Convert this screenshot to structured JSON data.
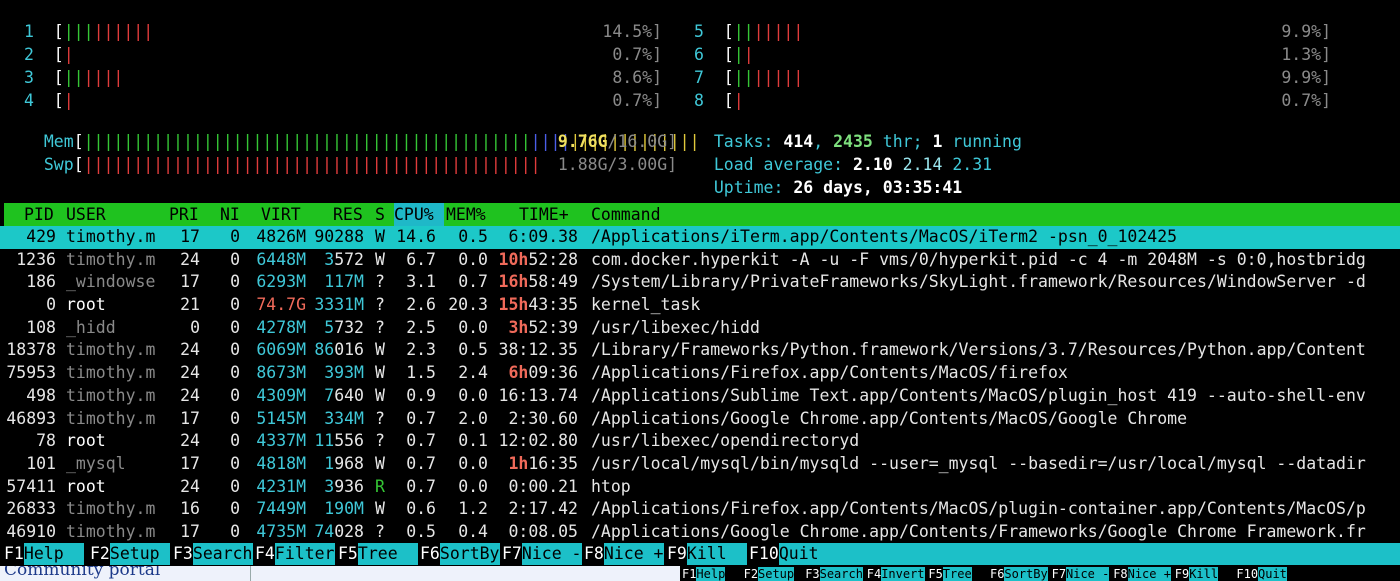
{
  "cpus": [
    {
      "id": "1",
      "pct": "14.5%]",
      "bars": [
        {
          "c": "green",
          "n": 3
        },
        {
          "c": "red",
          "n": 6
        }
      ]
    },
    {
      "id": "2",
      "pct": "0.7%]",
      "bars": [
        {
          "c": "red",
          "n": 1
        }
      ]
    },
    {
      "id": "3",
      "pct": "8.6%]",
      "bars": [
        {
          "c": "green",
          "n": 2
        },
        {
          "c": "red",
          "n": 4
        }
      ]
    },
    {
      "id": "4",
      "pct": "0.7%]",
      "bars": [
        {
          "c": "red",
          "n": 1
        }
      ]
    },
    {
      "id": "5",
      "pct": "9.9%]",
      "bars": [
        {
          "c": "green",
          "n": 2
        },
        {
          "c": "red",
          "n": 5
        }
      ]
    },
    {
      "id": "6",
      "pct": "1.3%]",
      "bars": [
        {
          "c": "green",
          "n": 1
        },
        {
          "c": "red",
          "n": 1
        }
      ]
    },
    {
      "id": "7",
      "pct": "9.9%]",
      "bars": [
        {
          "c": "green",
          "n": 2
        },
        {
          "c": "red",
          "n": 5
        }
      ]
    },
    {
      "id": "8",
      "pct": "0.7%]",
      "bars": [
        {
          "c": "red",
          "n": 1
        }
      ]
    }
  ],
  "mem": {
    "label": "Mem",
    "used": "9.76G",
    "total": "/16.0G]",
    "bars": [
      {
        "c": "green",
        "n": 45
      },
      {
        "c": "blue",
        "n": 4
      },
      {
        "c": "yellow",
        "n": 13
      }
    ]
  },
  "swp": {
    "label": "Swp",
    "used": "1.88G",
    "total": "/3.00G]",
    "bars": [
      {
        "c": "red",
        "n": 46
      }
    ]
  },
  "tasks": {
    "label": "Tasks:",
    "count": "414",
    "sep1": ", ",
    "threads": "2435",
    "thr": " thr;",
    "running": "1",
    "running_label": " running"
  },
  "load": {
    "label": "Load average:",
    "l1": "2.10",
    "l5": "2.14",
    "l15": "2.31"
  },
  "uptime": {
    "label": "Uptime:",
    "value": "26 days, 03:35:41"
  },
  "columns": {
    "pid": "PID",
    "user": "USER",
    "pri": "PRI",
    "ni": "NI",
    "virt": "VIRT",
    "res": "RES",
    "s": "S",
    "cpu": "CPU%",
    "mem": "MEM%",
    "time": "TIME+",
    "command": "Command"
  },
  "processes": [
    {
      "pid": "429",
      "user": "timothy.m",
      "pri": "17",
      "ni": "0",
      "virt": "4826M",
      "res": "90288",
      "s": "W",
      "cpu": "14.6",
      "mem": "0.5",
      "time": "6:09.38",
      "command": "/Applications/iTerm.app/Contents/MacOS/iTerm2 -psn_0_102425",
      "selected": true
    },
    {
      "pid": "1236",
      "user": "timothy.m",
      "pri": "24",
      "ni": "0",
      "virt": "6448M",
      "res": "3572",
      "s": "W",
      "cpu": "6.7",
      "mem": "0.0",
      "time_h": "10h",
      "time": "52:28",
      "command": "com.docker.hyperkit -A -u -F vms/0/hyperkit.pid -c 4 -m 2048M -s 0:0,hostbridg"
    },
    {
      "pid": "186",
      "user": "_windowse",
      "pri": "17",
      "ni": "0",
      "virt": "6293M",
      "res": "117M",
      "s": "?",
      "cpu": "3.1",
      "mem": "0.7",
      "time_h": "16h",
      "time": "58:49",
      "command": "/System/Library/PrivateFrameworks/SkyLight.framework/Resources/WindowServer -d"
    },
    {
      "pid": "0",
      "user": "root",
      "pri": "21",
      "ni": "0",
      "virt": "74.7G",
      "res": "3331M",
      "s": "?",
      "cpu": "2.6",
      "mem": "20.3",
      "time_h": "15h",
      "time": "43:35",
      "command": "kernel_task",
      "virt_red": true
    },
    {
      "pid": "108",
      "user": "_hidd",
      "pri": "0",
      "ni": "0",
      "virt": "4278M",
      "res": "5732",
      "s": "?",
      "cpu": "2.5",
      "mem": "0.0",
      "time_h": "3h",
      "time": "52:39",
      "command": "/usr/libexec/hidd"
    },
    {
      "pid": "18378",
      "user": "timothy.m",
      "pri": "24",
      "ni": "0",
      "virt": "6069M",
      "res": "86016",
      "s": "W",
      "cpu": "2.3",
      "mem": "0.5",
      "time": "38:12.35",
      "command": "/Library/Frameworks/Python.framework/Versions/3.7/Resources/Python.app/Content"
    },
    {
      "pid": "75953",
      "user": "timothy.m",
      "pri": "24",
      "ni": "0",
      "virt": "8673M",
      "res": "393M",
      "s": "W",
      "cpu": "1.5",
      "mem": "2.4",
      "time_h": "6h",
      "time": "09:36",
      "command": "/Applications/Firefox.app/Contents/MacOS/firefox"
    },
    {
      "pid": "498",
      "user": "timothy.m",
      "pri": "24",
      "ni": "0",
      "virt": "4309M",
      "res": "7640",
      "s": "W",
      "cpu": "0.9",
      "mem": "0.0",
      "time": "16:13.74",
      "command": "/Applications/Sublime Text.app/Contents/MacOS/plugin_host 419 --auto-shell-env"
    },
    {
      "pid": "46893",
      "user": "timothy.m",
      "pri": "17",
      "ni": "0",
      "virt": "5145M",
      "res": "334M",
      "s": "?",
      "cpu": "0.7",
      "mem": "2.0",
      "time": "2:30.60",
      "command": "/Applications/Google Chrome.app/Contents/MacOS/Google Chrome"
    },
    {
      "pid": "78",
      "user": "root",
      "pri": "24",
      "ni": "0",
      "virt": "4337M",
      "res": "11556",
      "s": "?",
      "cpu": "0.7",
      "mem": "0.1",
      "time": "12:02.80",
      "command": "/usr/libexec/opendirectoryd"
    },
    {
      "pid": "101",
      "user": "_mysql",
      "pri": "17",
      "ni": "0",
      "virt": "4818M",
      "res": "1968",
      "s": "W",
      "cpu": "0.7",
      "mem": "0.0",
      "time_h": "1h",
      "time": "16:35",
      "command": "/usr/local/mysql/bin/mysqld --user=_mysql --basedir=/usr/local/mysql --datadir"
    },
    {
      "pid": "57411",
      "user": "root",
      "pri": "24",
      "ni": "0",
      "virt": "4231M",
      "res": "3936",
      "s": "R",
      "cpu": "0.7",
      "mem": "0.0",
      "time": "0:00.21",
      "command": "htop",
      "running": true
    },
    {
      "pid": "26833",
      "user": "timothy.m",
      "pri": "16",
      "ni": "0",
      "virt": "7449M",
      "res": "190M",
      "s": "W",
      "cpu": "0.6",
      "mem": "1.2",
      "time": "2:17.42",
      "command": "/Applications/Firefox.app/Contents/MacOS/plugin-container.app/Contents/MacOS/p"
    },
    {
      "pid": "46910",
      "user": "timothy.m",
      "pri": "17",
      "ni": "0",
      "virt": "4735M",
      "res": "74028",
      "s": "?",
      "cpu": "0.5",
      "mem": "0.4",
      "time": "0:08.05",
      "command": "/Applications/Google Chrome.app/Contents/Frameworks/Google Chrome Framework.fr"
    }
  ],
  "fkeys": [
    {
      "key": "F1",
      "label": "Help  "
    },
    {
      "key": "F2",
      "label": "Setup "
    },
    {
      "key": "F3",
      "label": "Search"
    },
    {
      "key": "F4",
      "label": "Filter"
    },
    {
      "key": "F5",
      "label": "Tree  "
    },
    {
      "key": "F6",
      "label": "SortBy"
    },
    {
      "key": "F7",
      "label": "Nice -"
    },
    {
      "key": "F8",
      "label": "Nice +"
    },
    {
      "key": "F9",
      "label": "Kill  "
    },
    {
      "key": "F10",
      "label": "Quit"
    }
  ],
  "bottom": {
    "left_text": "Community portal",
    "fkeys2": [
      {
        "key": "F1",
        "label": "Help"
      },
      {
        "key": "F2",
        "label": "Setup"
      },
      {
        "key": "F3",
        "label": "Search"
      },
      {
        "key": "F4",
        "label": "Invert"
      },
      {
        "key": "F5",
        "label": "Tree"
      },
      {
        "key": "F6",
        "label": "SortBy"
      },
      {
        "key": "F7",
        "label": "Nice -"
      },
      {
        "key": "F8",
        "label": "Nice +"
      },
      {
        "key": "F9",
        "label": "Kill"
      },
      {
        "key": "F10",
        "label": "Quit"
      }
    ]
  },
  "colors": {
    "header_bg": "#1fc21f",
    "selected_bg": "#1cc8c8",
    "fkey_bg": "#1cc0c8"
  }
}
